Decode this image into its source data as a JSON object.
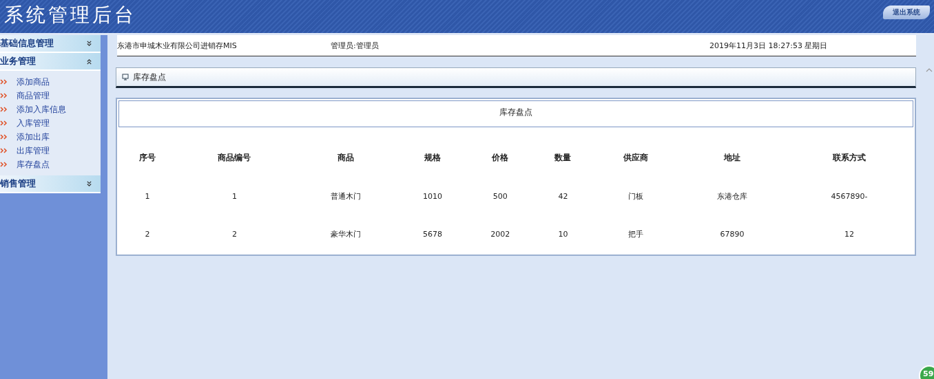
{
  "header": {
    "title": "系统管理后台",
    "logout_label": "退出系统"
  },
  "sidebar": {
    "sections": [
      {
        "label": "基础信息管理",
        "expanded": false
      },
      {
        "label": "业务管理",
        "expanded": true,
        "items": [
          {
            "label": "添加商品"
          },
          {
            "label": "商品管理"
          },
          {
            "label": "添加入库信息"
          },
          {
            "label": "入库管理"
          },
          {
            "label": "添加出库"
          },
          {
            "label": "出库管理"
          },
          {
            "label": "库存盘点"
          }
        ]
      },
      {
        "label": "销售管理",
        "expanded": false
      }
    ]
  },
  "top_bar": {
    "company": "东港市申城木业有限公司进销存MIS",
    "user": "管理员:管理员",
    "datetime": "2019年11月3日  18:27:53 星期日"
  },
  "panel": {
    "title": "库存盘点"
  },
  "table": {
    "caption": "库存盘点",
    "columns": [
      "序号",
      "商品编号",
      "商品",
      "规格",
      "价格",
      "数量",
      "供应商",
      "地址",
      "联系方式"
    ],
    "rows": [
      [
        "1",
        "1",
        "普通木门",
        "1010",
        "500",
        "42",
        "门板",
        "东港仓库",
        "4567890-"
      ],
      [
        "2",
        "2",
        "豪华木门",
        "5678",
        "2002",
        "10",
        "把手",
        "67890",
        "12"
      ]
    ]
  },
  "badge": "59"
}
